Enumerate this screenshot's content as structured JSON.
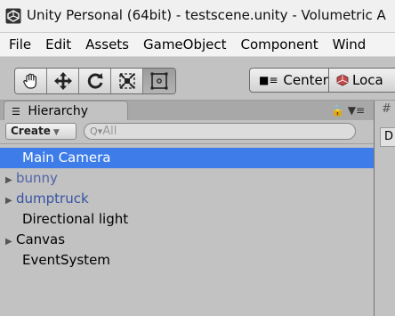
{
  "window": {
    "title": "Unity Personal (64bit) - testscene.unity - Volumetric A"
  },
  "menu": {
    "items": [
      "File",
      "Edit",
      "Assets",
      "GameObject",
      "Component",
      "Wind"
    ]
  },
  "toolbar": {
    "tools": [
      {
        "icon": "hand-icon",
        "active": false
      },
      {
        "icon": "move-icon",
        "active": false
      },
      {
        "icon": "rotate-icon",
        "active": false
      },
      {
        "icon": "scale-icon",
        "active": false
      },
      {
        "icon": "rect-icon",
        "active": true
      }
    ],
    "pivot_label": "Center",
    "space_label": "Loca"
  },
  "hierarchy": {
    "tab_label": "Hierarchy",
    "create_label": "Create",
    "search_placeholder": "All",
    "right_cell_label": "D",
    "rows": [
      {
        "label": "Main Camera",
        "selected": true,
        "expandable": false,
        "style": "normal"
      },
      {
        "label": "bunny",
        "selected": false,
        "expandable": true,
        "style": "prefab-missing"
      },
      {
        "label": "dumptruck",
        "selected": false,
        "expandable": true,
        "style": "prefab"
      },
      {
        "label": "Directional light",
        "selected": false,
        "expandable": false,
        "style": "normal"
      },
      {
        "label": "Canvas",
        "selected": false,
        "expandable": true,
        "style": "normal"
      },
      {
        "label": "EventSystem",
        "selected": false,
        "expandable": false,
        "style": "normal"
      }
    ]
  },
  "colors": {
    "selection": "#3e7de9",
    "panel_bg": "#c2c2c2",
    "prefab_text": "#3553a3"
  }
}
